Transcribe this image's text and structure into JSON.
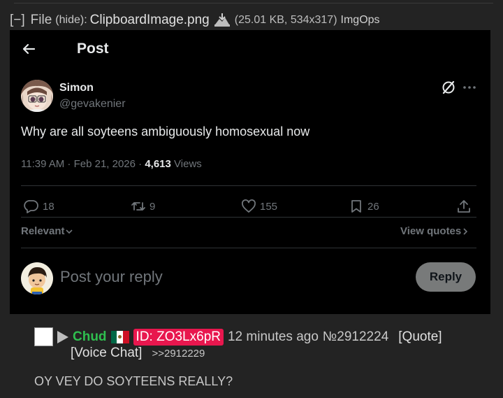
{
  "file": {
    "toggle": "[−]",
    "label": "File",
    "hide": "(hide):",
    "filename": "ClipboardImage.png",
    "meta": "(25.01 KB, 534x317)",
    "imgops": "ImgOps"
  },
  "tweet": {
    "header_title": "Post",
    "author_name": "Simon",
    "author_handle": "@gevakenier",
    "text": "Why are all soyteens ambiguously homosexual now",
    "meta_prefix": "11:39 AM · Feb 21, 2026 · ",
    "views_count": "4,613",
    "views_label": " Views",
    "actions": {
      "replies": "18",
      "reposts": "9",
      "likes": "155",
      "bookmarks": "26"
    },
    "relevant_label": "Relevant",
    "view_quotes_label": "View quotes",
    "reply_placeholder": "Post your reply",
    "reply_button": "Reply"
  },
  "post": {
    "name": "Chud",
    "flag": "mexico-flag",
    "id_badge": "ID: ZO3Lx6pR",
    "time": "12 minutes ago",
    "number": "№2912224",
    "quote_link": "[Quote]",
    "voice_chat": "[Voice Chat]",
    "backlink": ">>2912229",
    "body": "OY VEY DO SOYTEENS REALLY?"
  },
  "colors": {
    "page_bg": "#232323",
    "tweet_bg": "#000000",
    "name_green": "#2fbf4f",
    "id_badge_bg": "#e8174e",
    "muted": "#71767b"
  }
}
